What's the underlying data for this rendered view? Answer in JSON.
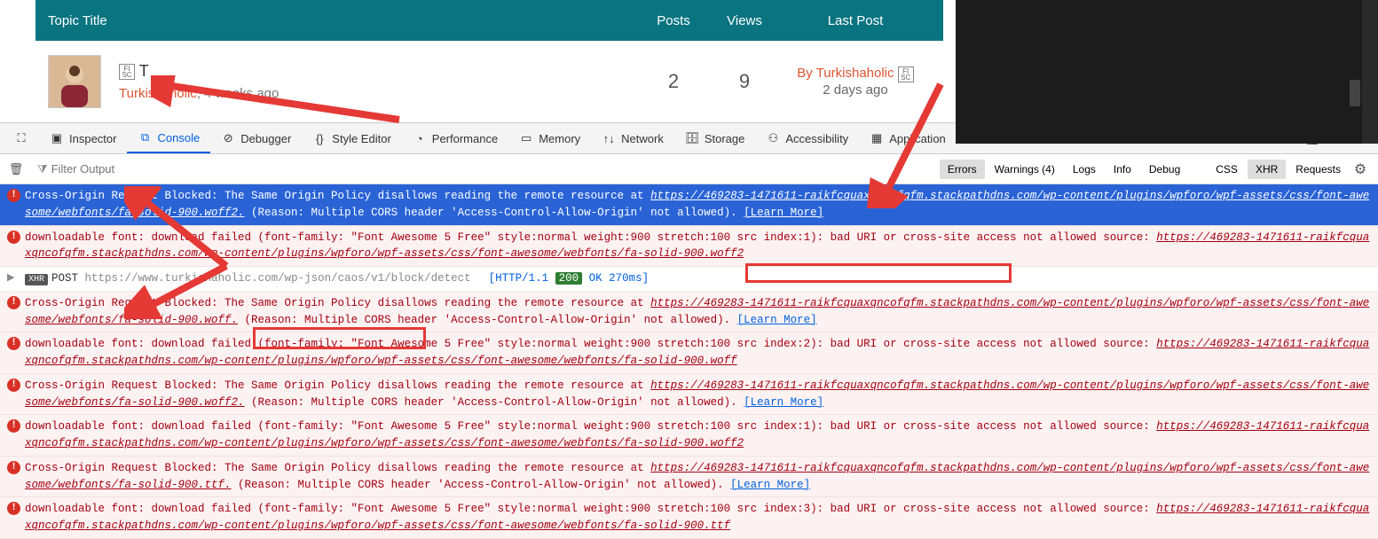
{
  "forum": {
    "header": {
      "title": "Topic Title",
      "posts": "Posts",
      "views": "Views",
      "last": "Last Post"
    },
    "row": {
      "topic_prefix": "T",
      "author": "Turkishaholic",
      "time": ", 4 weeks ago",
      "posts": "2",
      "views": "9",
      "by_label": "By ",
      "last_author": "Turkishaholic",
      "last_time": "2 days ago"
    }
  },
  "tabs": {
    "inspector": "Inspector",
    "console": "Console",
    "debugger": "Debugger",
    "style": "Style Editor",
    "performance": "Performance",
    "memory": "Memory",
    "network": "Network",
    "storage": "Storage",
    "accessibility": "Accessibility",
    "application": "Application"
  },
  "filterbar": {
    "placeholder": "Filter Output",
    "errors": "Errors",
    "warnings": "Warnings (4)",
    "logs": "Logs",
    "info": "Info",
    "debug": "Debug",
    "css": "CSS",
    "xhr": "XHR",
    "requests": "Requests"
  },
  "msgs": [
    {
      "type": "error-selected",
      "text1": "Cross-Origin Request Blocked: The Same Origin Policy disallows reading the remote resource at ",
      "url": "https://469283-1471611-raikfcquaxqncofqfm.stackpathdns.com/wp-content/plugins/wpforo/wpf-assets/css/font-awesome/webfonts/fa-solid-900.woff2.",
      "text2": " (Reason: Multiple CORS header 'Access-Control-Allow-Origin' not allowed). ",
      "learn": "[Learn More]"
    },
    {
      "type": "error",
      "text1": "downloadable font: download failed (font-family: \"Font Awesome 5 Free\" style:normal weight:900 stretch:100 src index:1): bad URI or cross-site access not allowed source: ",
      "url": "https://469283-1471611-raikfcquaxqncofqfm.stackpathdns.com/wp-content/plugins/wpforo/wpf-assets/css/font-awesome/webfonts/fa-solid-900.woff2"
    },
    {
      "type": "xhr",
      "method": "POST",
      "url_plain": "https://www.turkishaholic.com/wp-json/caos/v1/block/detect",
      "http": "[HTTP/1.1 ",
      "status": "200",
      "rest": " OK 270ms]"
    },
    {
      "type": "error",
      "text1": "Cross-Origin Request Blocked: The Same Origin Policy disallows reading the remote resource at ",
      "url": "https://469283-1471611-raikfcquaxqncofqfm.stackpathdns.com/wp-content/plugins/wpforo/wpf-assets/css/font-awesome/webfonts/fa-solid-900.woff.",
      "text2": " (Reason: Multiple CORS header 'Access-Control-Allow-Origin' not allowed). ",
      "learn": "[Learn More]"
    },
    {
      "type": "error",
      "text1": "downloadable font: download failed (font-family: \"Font Awesome 5 Free\" style:normal weight:900 stretch:100 src index:2): bad URI or cross-site access not allowed source: ",
      "url": "https://469283-1471611-raikfcquaxqncofqfm.stackpathdns.com/wp-content/plugins/wpforo/wpf-assets/css/font-awesome/webfonts/fa-solid-900.woff"
    },
    {
      "type": "error",
      "text1": "Cross-Origin Request Blocked: The Same Origin Policy disallows reading the remote resource at ",
      "url": "https://469283-1471611-raikfcquaxqncofqfm.stackpathdns.com/wp-content/plugins/wpforo/wpf-assets/css/font-awesome/webfonts/fa-solid-900.woff2.",
      "text2": " (Reason: Multiple CORS header 'Access-Control-Allow-Origin' not allowed). ",
      "learn": "[Learn More]"
    },
    {
      "type": "error",
      "text1": "downloadable font: download failed (font-family: \"Font Awesome 5 Free\" style:normal weight:900 stretch:100 src index:1): bad URI or cross-site access not allowed source: ",
      "url": "https://469283-1471611-raikfcquaxqncofqfm.stackpathdns.com/wp-content/plugins/wpforo/wpf-assets/css/font-awesome/webfonts/fa-solid-900.woff2"
    },
    {
      "type": "error",
      "text1": "Cross-Origin Request Blocked: The Same Origin Policy disallows reading the remote resource at ",
      "url": "https://469283-1471611-raikfcquaxqncofqfm.stackpathdns.com/wp-content/plugins/wpforo/wpf-assets/css/font-awesome/webfonts/fa-solid-900.ttf.",
      "text2": " (Reason: Multiple CORS header 'Access-Control-Allow-Origin' not allowed). ",
      "learn": "[Learn More]"
    },
    {
      "type": "error",
      "text1": "downloadable font: download failed (font-family: \"Font Awesome 5 Free\" style:normal weight:900 stretch:100 src index:3): bad URI or cross-site access not allowed source: ",
      "url": "https://469283-1471611-raikfcquaxqncofqfm.stackpathdns.com/wp-content/plugins/wpforo/wpf-assets/css/font-awesome/webfonts/fa-solid-900.ttf"
    }
  ]
}
